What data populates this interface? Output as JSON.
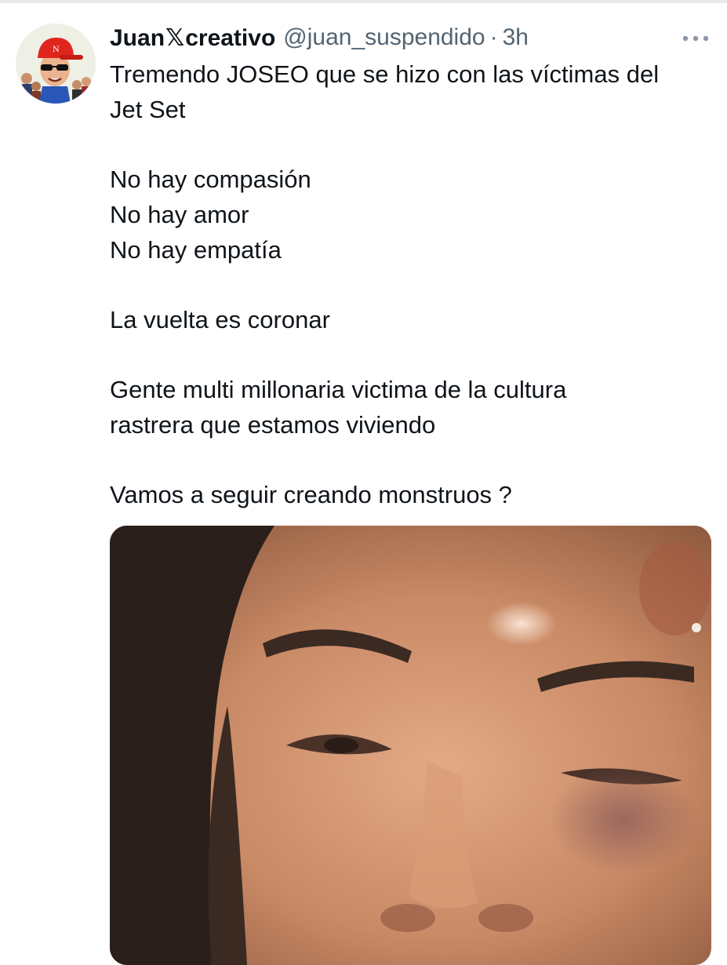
{
  "tweet": {
    "author": {
      "name_part1": "Juan",
      "name_glyph": "𝕏",
      "name_part2": "creativo",
      "handle": "@juan_suspendido",
      "separator": "·",
      "time": "3h",
      "avatar_icon": "avatar-cartoon-red-cap"
    },
    "more_icon": "more-horizontal-icon",
    "lines": [
      "Tremendo JOSEO que se hizo con las víctimas del",
      "Jet Set",
      "",
      "No hay compasión",
      "No hay amor",
      "No hay empatía",
      "",
      "La vuelta es coronar",
      "",
      "Gente multi millonaria victima de la cultura",
      "rastrera que estamos viviendo",
      "",
      "Vamos a seguir creando monstruos ?"
    ],
    "media": {
      "kind": "photo",
      "subject": "close-up face photo"
    }
  },
  "colors": {
    "text_primary": "#0f1419",
    "text_secondary": "#536471",
    "divider": "#e7e9ea",
    "avatar_cap": "#e0261c"
  }
}
